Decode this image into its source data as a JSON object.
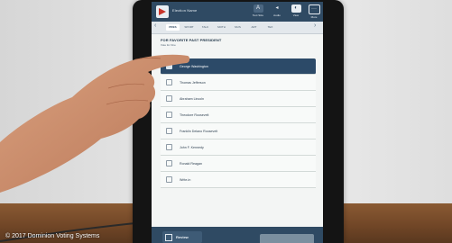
{
  "topbar": {
    "election_name": "Election Name",
    "text_size_label": "Text Size",
    "audio_label": "Audio",
    "view_label": "View",
    "more_label": "More"
  },
  "tabs": [
    "PRES",
    "SPORT",
    "TALK",
    "MOTH",
    "MUS",
    "ART",
    "TEX"
  ],
  "contest": {
    "title": "FOR FAVORITE PAST PRESIDENT",
    "subtitle": "Vote for One"
  },
  "candidates": [
    {
      "name": "George Washington",
      "selected": true
    },
    {
      "name": "Thomas Jefferson",
      "selected": false
    },
    {
      "name": "Abraham Lincoln",
      "selected": false
    },
    {
      "name": "Theodore Roosevelt",
      "selected": false
    },
    {
      "name": "Franklin Delano Roosevelt",
      "selected": false
    },
    {
      "name": "John F. Kennedy",
      "selected": false
    },
    {
      "name": "Ronald Reagan",
      "selected": false
    },
    {
      "name": "Write-in",
      "selected": false
    }
  ],
  "bottombar": {
    "review_label": "Review"
  },
  "copyright": "© 2017 Dominion Voting Systems",
  "colors": {
    "topbar": "#2f4a63",
    "selected_row": "#2c4a68",
    "screen_bg": "#f3f5f4"
  }
}
